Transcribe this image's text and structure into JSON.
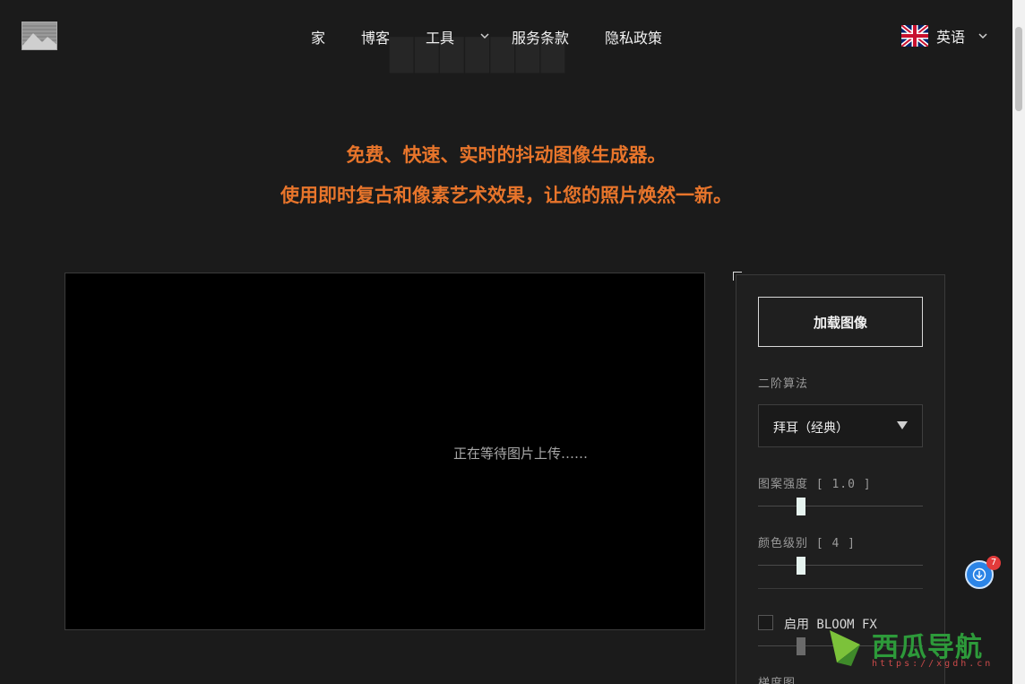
{
  "nav": {
    "items": [
      "家",
      "博客",
      "工具",
      "服务条款",
      "隐私政策"
    ],
    "language_label": "英语"
  },
  "hero": {
    "line1": "免费、快速、实时的抖动图像生成器。",
    "line2": "使用即时复古和像素艺术效果，让您的照片焕然一新。"
  },
  "preview": {
    "waiting_text": "正在等待图片上传……"
  },
  "panel": {
    "load_button": "加载图像",
    "algorithm_label": "二阶算法",
    "algorithm_value": "拜耳（经典）",
    "pattern_label": "图案强度 [ 1.0 ]",
    "pattern_value": 1.0,
    "color_levels_label": "颜色级别 [ 4 ]",
    "color_levels_value": 4,
    "bloom_label": "启用 BLOOM FX",
    "bloom_enabled": false,
    "gradient_label": "梯度图"
  },
  "floating": {
    "badge_count": "7"
  },
  "watermark": {
    "brand": "西瓜导航",
    "url": "https://xgdh.cn"
  },
  "colors": {
    "accent": "#e8752b",
    "background": "#1b1b1b",
    "panel": "#1f1f1f"
  },
  "icons": {
    "logo": "image-placeholder-icon",
    "flag": "uk-flag-icon",
    "dropdown": "chevron-down-icon",
    "floating": "download-arrow-icon"
  }
}
